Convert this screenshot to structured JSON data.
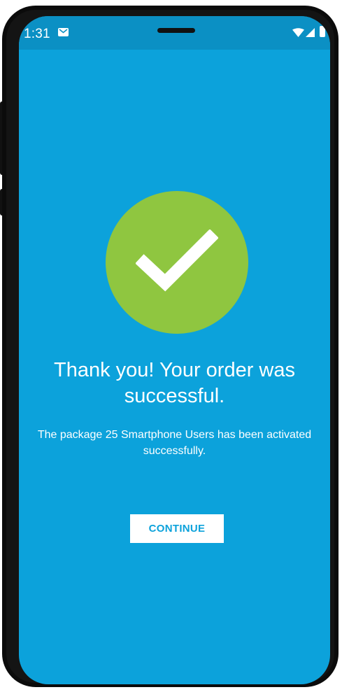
{
  "status_bar": {
    "time": "1:31",
    "icons": [
      "gmail-icon",
      "wifi-icon",
      "cell-signal-icon",
      "battery-icon"
    ]
  },
  "confirmation": {
    "icon": "check-circle-icon",
    "title": "Thank you! Your order was successful.",
    "message": "The package 25 Smartphone Users has been activated successfully.",
    "button_label": "CONTINUE"
  },
  "colors": {
    "screen_background": "#0ca2db",
    "success_circle": "#8fc640",
    "button_background": "#ffffff",
    "button_text": "#0ca2db"
  }
}
